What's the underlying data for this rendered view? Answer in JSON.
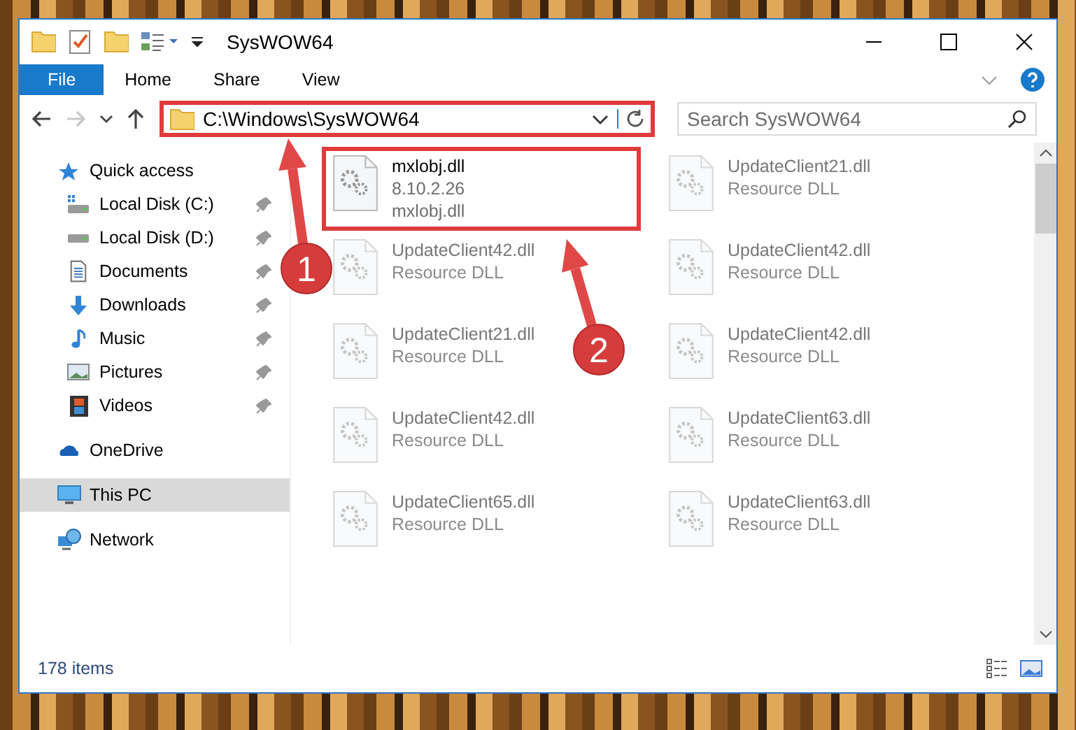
{
  "window": {
    "title": "SysWOW64"
  },
  "quick_toolbar": [
    {
      "kind": "folder"
    },
    {
      "kind": "properties"
    },
    {
      "kind": "new_folder"
    },
    {
      "kind": "customize"
    }
  ],
  "ribbon_tabs": [
    {
      "label": "File",
      "kind": "file"
    },
    {
      "label": "Home",
      "kind": "tab"
    },
    {
      "label": "Share",
      "kind": "tab"
    },
    {
      "label": "View",
      "kind": "tab"
    }
  ],
  "nav_buttons": [
    {
      "kind": "back",
      "disabled": false
    },
    {
      "kind": "forward",
      "disabled": true
    },
    {
      "kind": "recent",
      "disabled": false
    },
    {
      "kind": "up",
      "disabled": false
    }
  ],
  "address": {
    "path": "C:\\Windows\\SysWOW64",
    "highlighted": true
  },
  "search": {
    "placeholder": "Search SysWOW64"
  },
  "sidebar": {
    "items": [
      {
        "label": "Quick access",
        "kind": "star",
        "selected": false,
        "children": [
          {
            "label": "Local Disk (C:)",
            "kind": "system_drive",
            "pinned": true
          },
          {
            "label": "Local Disk (D:)",
            "kind": "drive",
            "pinned": true
          },
          {
            "label": "Documents",
            "kind": "documents",
            "pinned": true
          },
          {
            "label": "Downloads",
            "kind": "downloads",
            "pinned": true
          },
          {
            "label": "Music",
            "kind": "music",
            "pinned": true
          },
          {
            "label": "Pictures",
            "kind": "pictures",
            "pinned": true
          },
          {
            "label": "Videos",
            "kind": "videos",
            "pinned": true
          }
        ]
      },
      {
        "label": "OneDrive",
        "kind": "cloud",
        "selected": false
      },
      {
        "label": "This PC",
        "kind": "computer",
        "selected": true
      },
      {
        "label": "Network",
        "kind": "network",
        "selected": false
      }
    ]
  },
  "files": [
    {
      "name": "mxlobj.dll",
      "details": [
        "8.10.2.26",
        "mxlobj.dll"
      ],
      "blurred": false,
      "highlighted": true
    },
    {
      "name": "UpdateClient21.dll",
      "details": [
        "Resource DLL"
      ],
      "blurred": true,
      "highlighted": false
    },
    {
      "name": "UpdateClient42.dll",
      "details": [
        "Resource DLL"
      ],
      "blurred": true,
      "highlighted": false
    },
    {
      "name": "UpdateClient42.dll",
      "details": [
        "Resource DLL"
      ],
      "blurred": true,
      "highlighted": false
    },
    {
      "name": "UpdateClient21.dll",
      "details": [
        "Resource DLL"
      ],
      "blurred": true,
      "highlighted": false
    },
    {
      "name": "UpdateClient42.dll",
      "details": [
        "Resource DLL"
      ],
      "blurred": true,
      "highlighted": false
    },
    {
      "name": "UpdateClient42.dll",
      "details": [
        "Resource DLL"
      ],
      "blurred": true,
      "highlighted": false
    },
    {
      "name": "UpdateClient63.dll",
      "details": [
        "Resource DLL"
      ],
      "blurred": true,
      "highlighted": false
    },
    {
      "name": "UpdateClient65.dll",
      "details": [
        "Resource DLL"
      ],
      "blurred": true,
      "highlighted": false
    },
    {
      "name": "UpdateClient63.dll",
      "details": [
        "Resource DLL"
      ],
      "blurred": true,
      "highlighted": false
    }
  ],
  "annotations": [
    {
      "number": "1"
    },
    {
      "number": "2"
    }
  ],
  "status_bar": {
    "item_count": "178 items"
  },
  "view_buttons": [
    {
      "kind": "details"
    },
    {
      "kind": "large_icons"
    }
  ]
}
